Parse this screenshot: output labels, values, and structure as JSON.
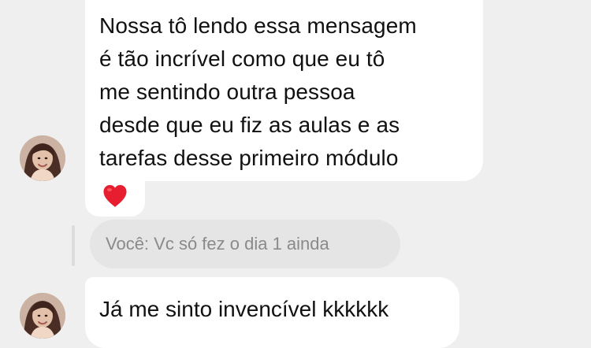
{
  "conversation": {
    "messages": [
      {
        "text_lines": [
          "Nossa tô lendo essa mensagem",
          "é tão incrível como que eu tô",
          "me sentindo outra pessoa",
          "desde que eu fiz as aulas e as",
          "tarefas desse primeiro módulo"
        ],
        "reaction": "heart-icon"
      },
      {
        "reply_preview": "Você: Vc só fez o dia 1 ainda"
      },
      {
        "text": "Já me sinto invencível kkkkkk"
      }
    ]
  },
  "colors": {
    "background": "#efefef",
    "bubble": "#ffffff",
    "reply_bubble": "#e5e5e5",
    "heart": "#e61e2f"
  }
}
